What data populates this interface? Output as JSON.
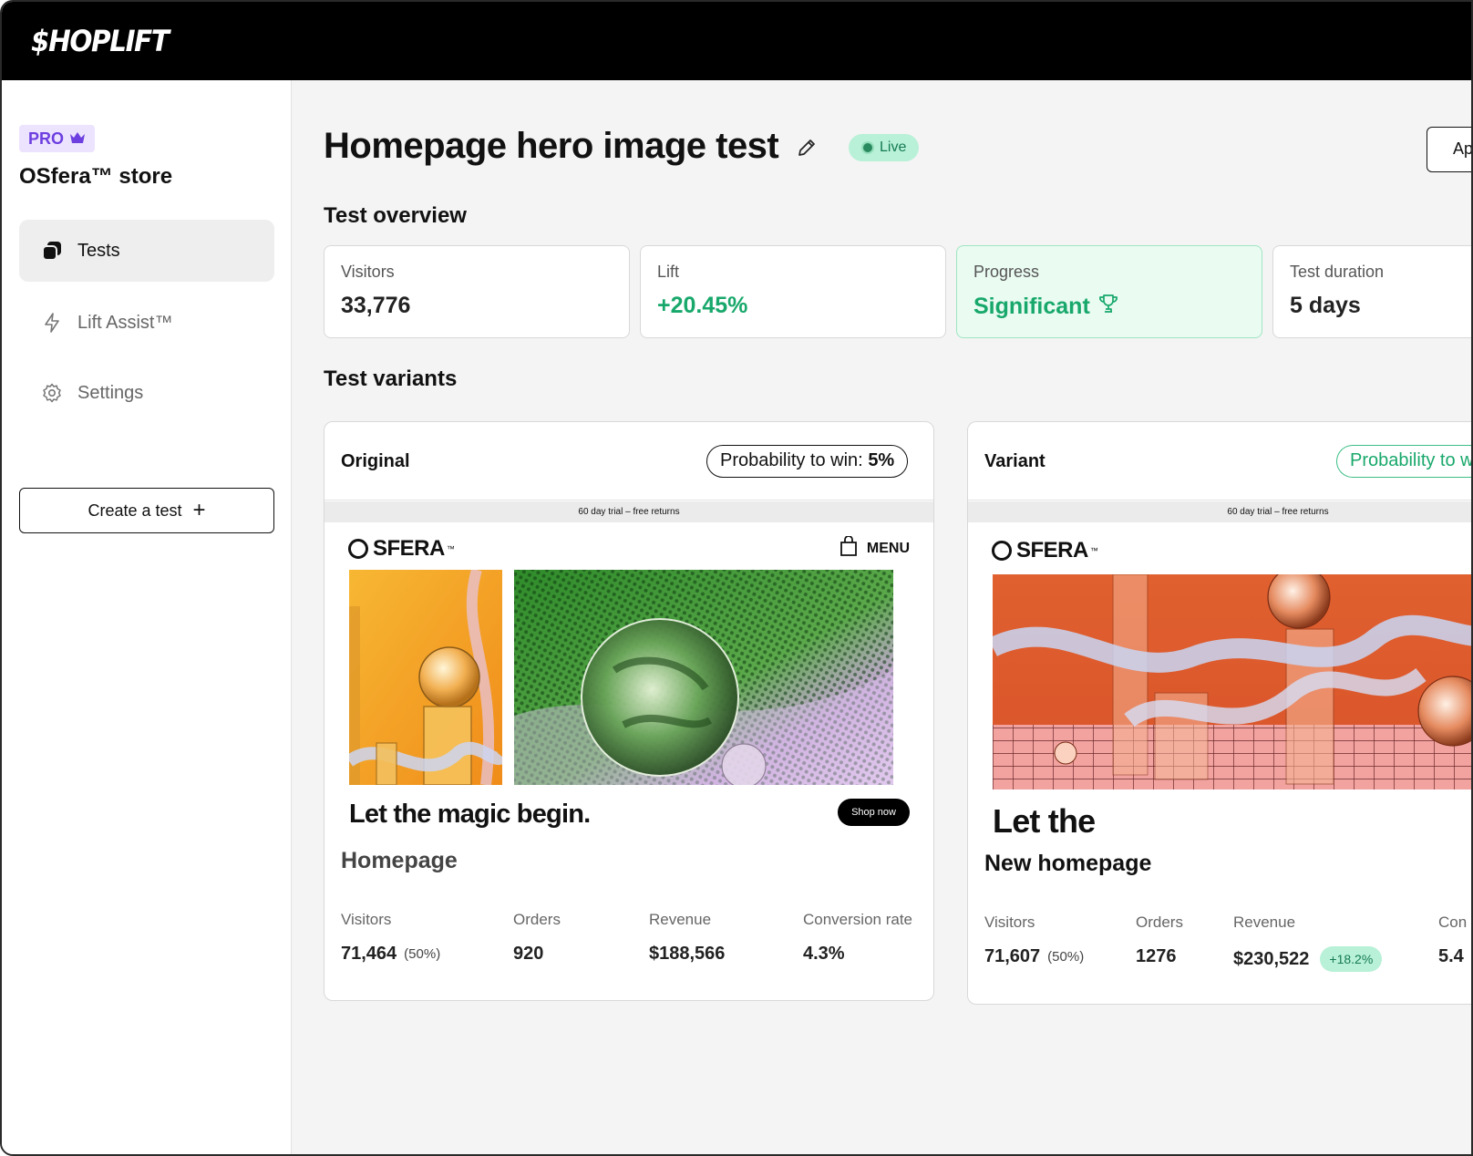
{
  "app": {
    "logo": "$HOPLIFT"
  },
  "sidebar": {
    "plan_badge": "PRO",
    "store_name": "OSfera™ store",
    "items": [
      {
        "label": "Tests",
        "icon": "tests-icon",
        "active": true
      },
      {
        "label": "Lift Assist™",
        "icon": "bolt-icon",
        "active": false
      },
      {
        "label": "Settings",
        "icon": "gear-icon",
        "active": false
      }
    ],
    "create_button": "Create a test",
    "create_plus": "+"
  },
  "header": {
    "title": "Homepage hero image test",
    "status": "Live",
    "apply_button": "App"
  },
  "overview": {
    "title": "Test overview",
    "cards": [
      {
        "label": "Visitors",
        "value": "33,776"
      },
      {
        "label": "Lift",
        "value": "+20.45%"
      },
      {
        "label": "Progress",
        "value": "Significant"
      },
      {
        "label": "Test duration",
        "value": "5 days"
      }
    ]
  },
  "variants": {
    "title": "Test variants",
    "items": [
      {
        "name": "Original",
        "probability_label": "Probability to win:",
        "probability_value": "5%",
        "preview": {
          "promo": "60 day trial – free returns",
          "brand": "SFERA",
          "brand_tm": "™",
          "menu": "MENU",
          "headline": "Let the magic begin.",
          "cta": "Shop now"
        },
        "page_name": "Homepage",
        "metrics": [
          {
            "label": "Visitors",
            "value": "71,464",
            "sub": "(50%)"
          },
          {
            "label": "Orders",
            "value": "920"
          },
          {
            "label": "Revenue",
            "value": "$188,566"
          },
          {
            "label": "Conversion rate",
            "value": "4.3%"
          }
        ]
      },
      {
        "name": "Variant",
        "probability_label": "Probability to w",
        "preview": {
          "promo": "60 day trial – free returns",
          "brand": "SFERA",
          "brand_tm": "™",
          "headline": "Let the"
        },
        "page_name": "New homepage",
        "metrics": [
          {
            "label": "Visitors",
            "value": "71,607",
            "sub": "(50%)"
          },
          {
            "label": "Orders",
            "value": "1276"
          },
          {
            "label": "Revenue",
            "value": "$230,522",
            "tag": "+18.2%"
          },
          {
            "label": "Con",
            "value": "5.4"
          }
        ]
      }
    ]
  },
  "colors": {
    "brand_purple": "#6d3fe0",
    "success_green": "#18a86b",
    "live_badge_bg": "#b8f1d7",
    "topbar_bg": "#000000"
  }
}
